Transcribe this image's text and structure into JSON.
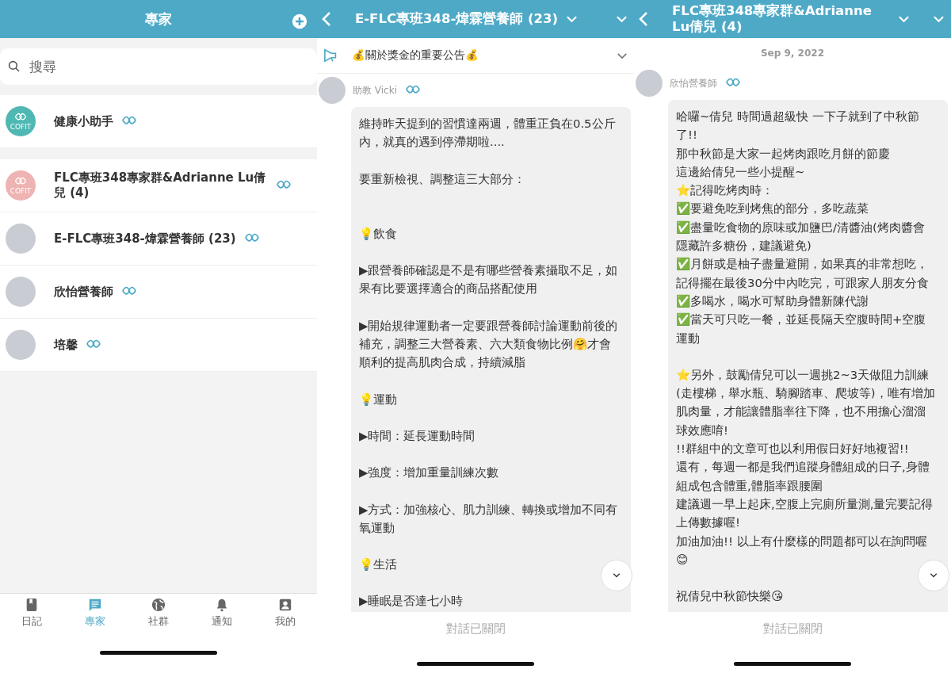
{
  "experts_screen": {
    "title": "專家",
    "search": {
      "placeholder": "搜尋"
    },
    "sections": [
      [
        {
          "name": "健康小助手",
          "kind": "logo",
          "color": "#4fb8b3",
          "logo_text": "COFIT"
        }
      ],
      [
        {
          "name": "FLC專班348專家群&Adrianne Lu倩兒 (4)",
          "kind": "logo",
          "color": "#eeb3b3",
          "logo_text": "COFIT"
        },
        {
          "name": "E-FLC專班348-煒霖營養師 (23)",
          "kind": "photo"
        },
        {
          "name": "欣怡營養師",
          "kind": "photo"
        },
        {
          "name": "培馨",
          "kind": "photo"
        }
      ]
    ],
    "tabs": [
      {
        "label": "日記",
        "kind": "book",
        "selected": false
      },
      {
        "label": "專家",
        "kind": "chat",
        "selected": true
      },
      {
        "label": "社群",
        "kind": "globe",
        "selected": false
      },
      {
        "label": "通知",
        "kind": "bell",
        "selected": false
      },
      {
        "label": "我的",
        "kind": "person",
        "selected": false
      }
    ]
  },
  "chat_screens": [
    {
      "title": "E-FLC專班348-煒霖營養師 (23)",
      "announcement": "💰關於獎金的重要公告💰",
      "messages": [
        {
          "sender": "助教 Vicki",
          "paragraphs": [
            [
              "維持昨天提到的習慣達兩週，體重正負在0.5公斤內，就真的遇到停滯期啦...."
            ],
            [
              "要重新檢視、調整這三大部分："
            ],
            [
              "💡飲食"
            ],
            [
              "▶跟營養師確認是不是有哪些營養素攝取不足，如果有比要選擇適合的商品搭配使用"
            ],
            [
              "▶開始規律運動者一定要跟營養師討論運動前後的補充，調整三大營養素、六大類食物比例🤗才會順利的提高肌肉合成，持續減脂"
            ],
            [
              "💡運動"
            ],
            [
              "▶時間：延長運動時間"
            ],
            [
              "▶強度：增加重量訓練次數"
            ],
            [
              "▶方式：加強核心、肌力訓練、轉換或增加不同有氧運動"
            ],
            [
              "💡生活"
            ],
            [
              "▶睡眠是否達七小時"
            ]
          ]
        }
      ],
      "footer": "對話已關閉"
    },
    {
      "title": "FLC專班348專家群&Adrianne Lu倩兒 (4)",
      "date": "Sep 9, 2022",
      "messages": [
        {
          "sender": "欣怡營養師",
          "paragraphs": [
            [
              "哈囉~倩兒 時間過超級快 一下子就到了中秋節了!!",
              "那中秋節是大家一起烤肉跟吃月餅的節慶",
              "這邊給倩兒一些小提醒~",
              "⭐記得吃烤肉時：",
              "✅要避免吃到烤焦的部分，多吃蔬菜",
              "✅盡量吃食物的原味或加鹽巴/清醬油(烤肉醬會隱藏許多糖份，建議避免)",
              "✅月餅或是柚子盡量避開，如果真的非常想吃，記得擺在最後30分中內吃完，可跟家人朋友分食",
              "✅多喝水，喝水可幫助身體新陳代謝",
              "✅當天可只吃一餐，並延長隔天空腹時間+空腹運動"
            ],
            [
              "⭐另外，鼓勵倩兒可以一週挑2~3天做阻力訓練(走樓梯，舉水瓶、騎腳踏車、爬坡等)，唯有增加肌肉量，才能讓體脂率往下降，也不用擔心溜溜球效應唷!",
              "!!群組中的文章可也以利用假日好好地複習!!",
              "還有，每週一都是我們追蹤身體組成的日子,身體組成包含體重,體脂率跟腰圍",
              "建議週一早上起床,空腹上完廁所量測,量完要記得上傳數據喔!",
              "加油加油!! 以上有什麼樣的問題都可以在詢問喔😊"
            ],
            [
              "祝倩兒中秋節快樂😘"
            ]
          ]
        }
      ],
      "footer": "對話已關閉"
    }
  ]
}
